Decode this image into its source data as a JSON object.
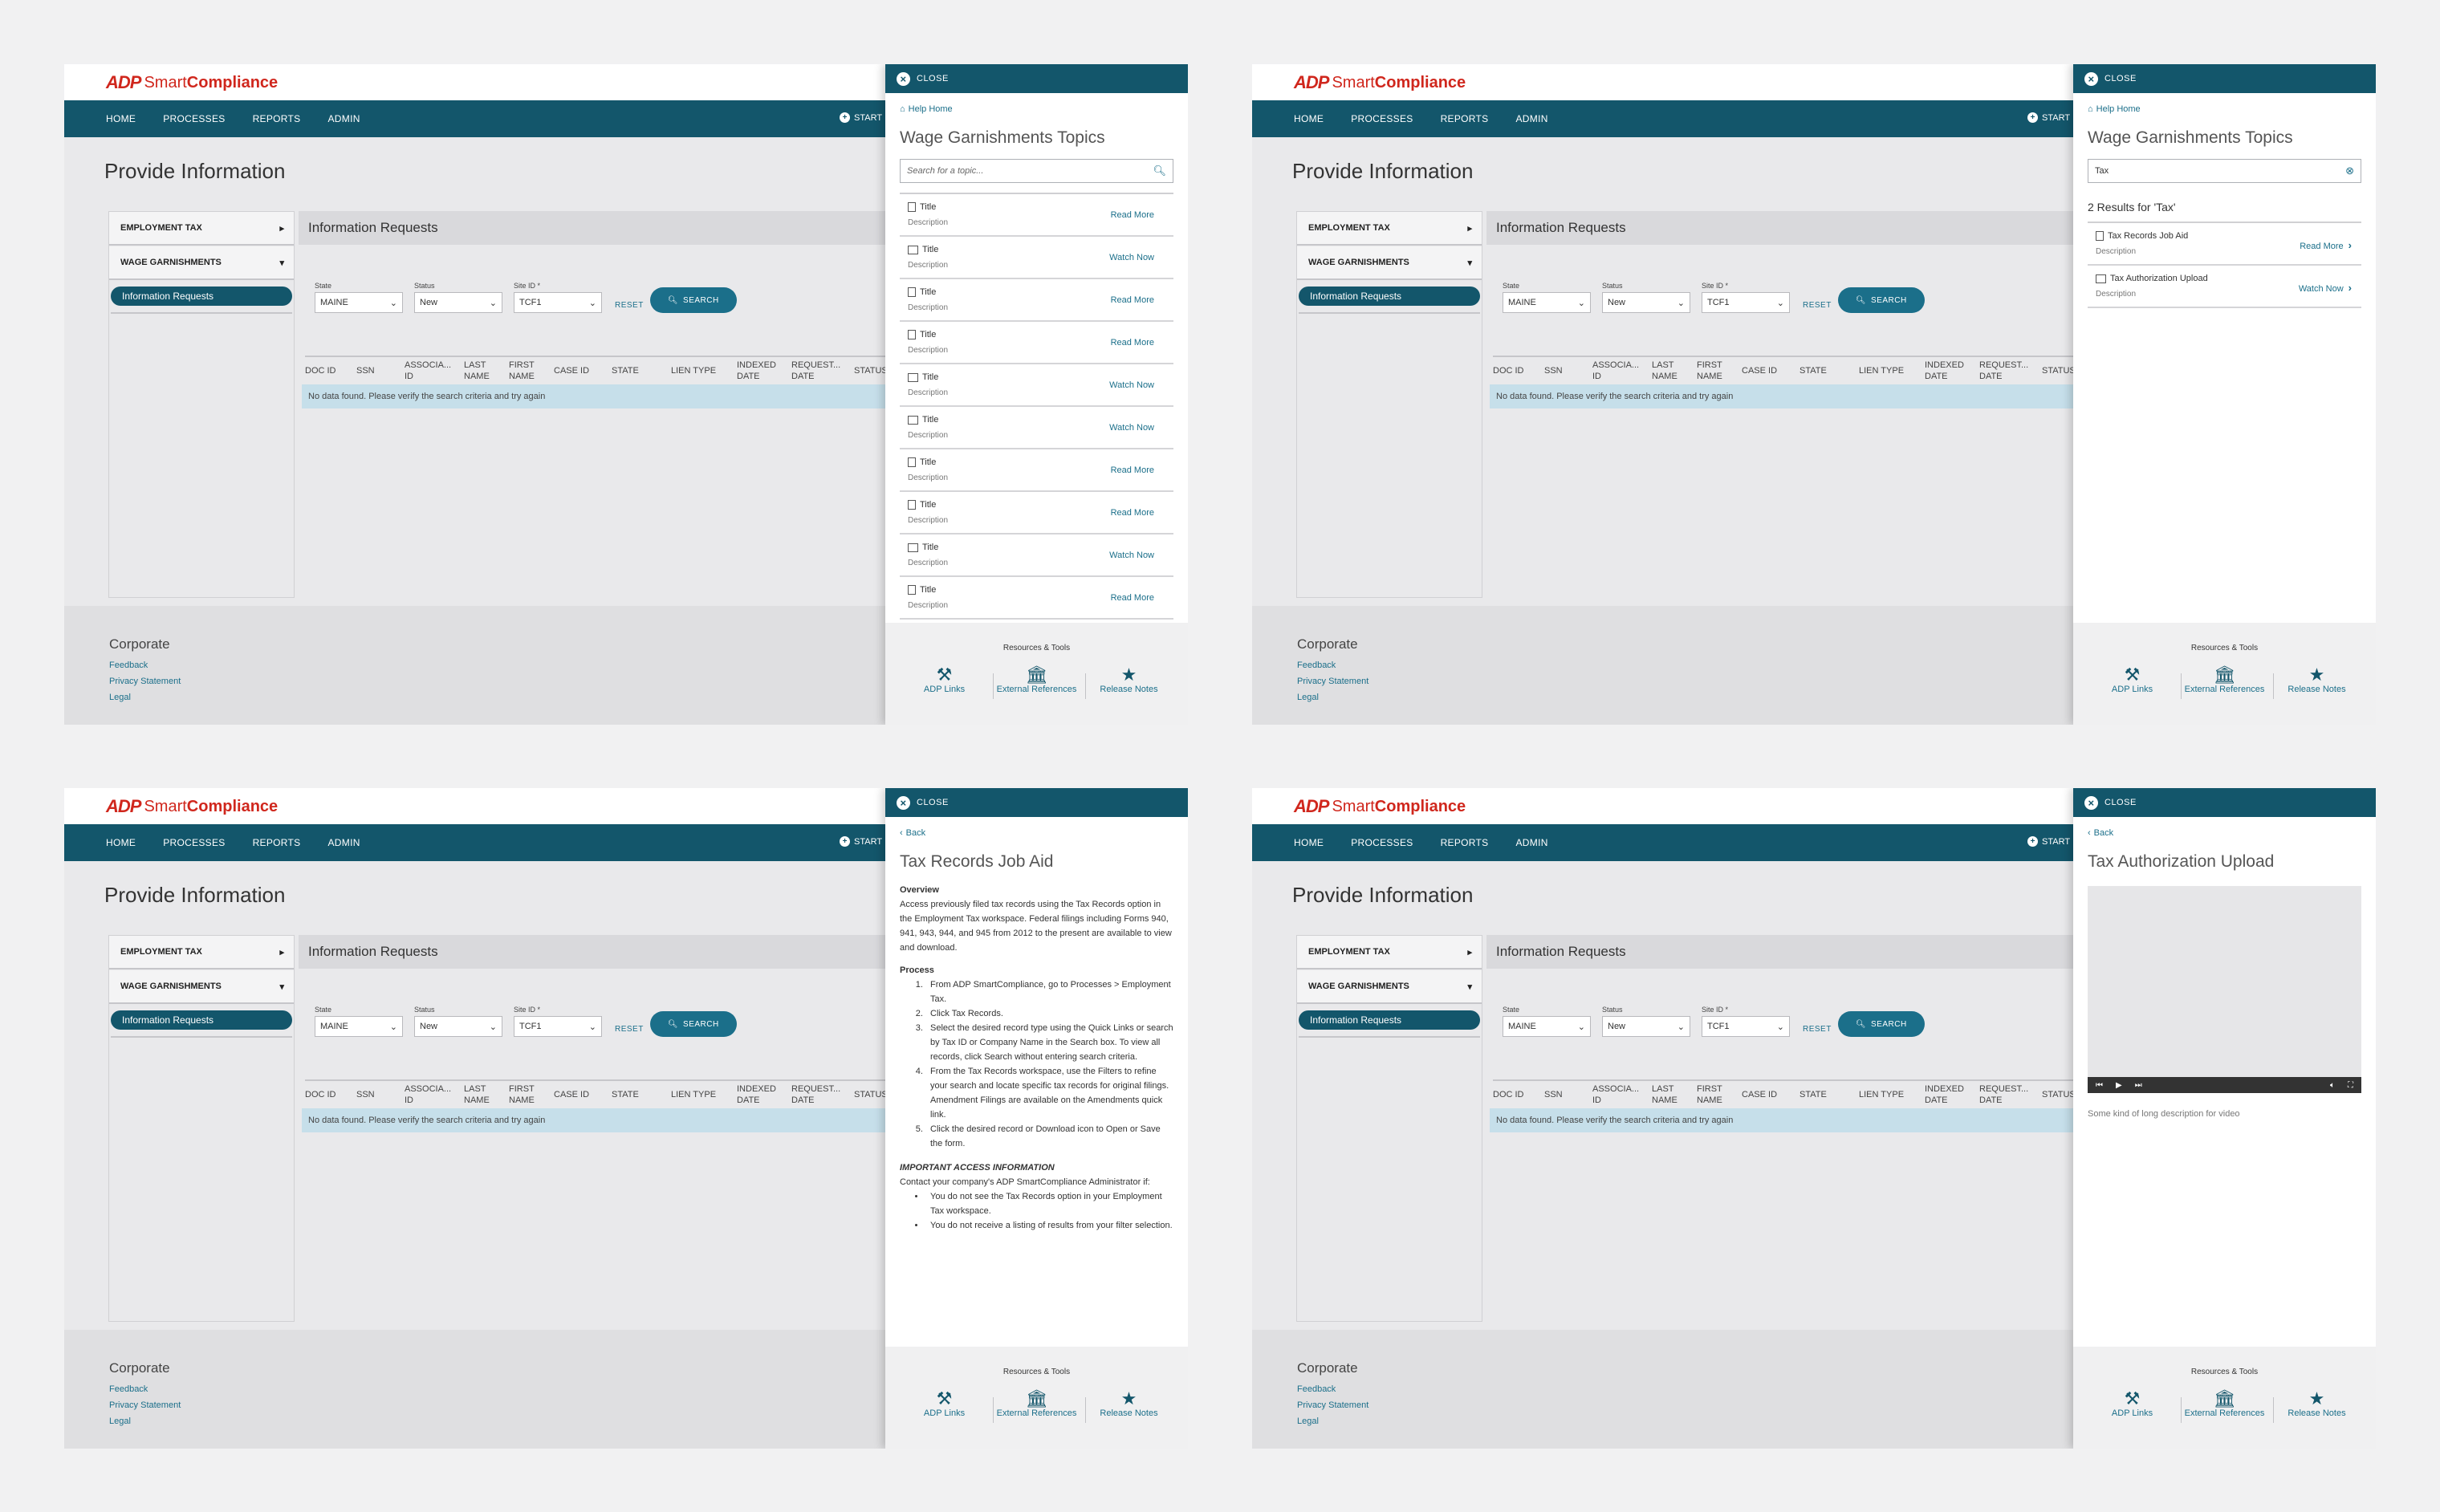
{
  "app": {
    "logo_badge": "ADP",
    "logo_smart": "Smart",
    "logo_compliance": "Compliance",
    "nav": [
      "HOME",
      "PROCESSES",
      "REPORTS",
      "ADMIN"
    ],
    "nav_right": "START",
    "page_title": "Provide Information",
    "sidebar": {
      "employment_tax": "EMPLOYMENT TAX",
      "wage_garnishments": "WAGE GARNISHMENTS",
      "active_item": "Information Requests"
    },
    "content_title": "Information Requests",
    "filters": {
      "state_label": "State",
      "state_value": "MAINE",
      "status_label": "Status",
      "status_value": "New",
      "site_label": "Site ID *",
      "site_value": "TCF1",
      "reset": "RESET",
      "search": "SEARCH"
    },
    "table": {
      "columns": [
        "DOC ID",
        "SSN",
        "ASSOCIA... ID",
        "LAST NAME",
        "FIRST NAME",
        "CASE ID",
        "STATE",
        "LIEN TYPE",
        "INDEXED DATE",
        "REQUEST... DATE",
        "STATUS"
      ],
      "empty": "No data found. Please verify the search criteria and try again"
    },
    "footer": {
      "title": "Corporate",
      "links": [
        "Feedback",
        "Privacy Statement",
        "Legal"
      ]
    }
  },
  "panel": {
    "close": "CLOSE",
    "help_home": "Help Home",
    "back": "Back",
    "topics_title": "Wage Garnishments Topics",
    "search_placeholder": "Search for a topic...",
    "search_value": "Tax",
    "topics": [
      {
        "type": "doc",
        "title": "Title",
        "desc": "Description",
        "action": "Read More"
      },
      {
        "type": "video",
        "title": "Title",
        "desc": "Description",
        "action": "Watch Now"
      },
      {
        "type": "doc",
        "title": "Title",
        "desc": "Description",
        "action": "Read More"
      },
      {
        "type": "doc",
        "title": "Title",
        "desc": "Description",
        "action": "Read More"
      },
      {
        "type": "video",
        "title": "Title",
        "desc": "Description",
        "action": "Watch Now"
      },
      {
        "type": "video",
        "title": "Title",
        "desc": "Description",
        "action": "Watch Now"
      },
      {
        "type": "doc",
        "title": "Title",
        "desc": "Description",
        "action": "Read More"
      },
      {
        "type": "doc",
        "title": "Title",
        "desc": "Description",
        "action": "Read More"
      },
      {
        "type": "video",
        "title": "Title",
        "desc": "Description",
        "action": "Watch Now"
      },
      {
        "type": "doc",
        "title": "Title",
        "desc": "Description",
        "action": "Read More"
      }
    ],
    "results_count": "2 Results for 'Tax'",
    "results": [
      {
        "type": "doc",
        "title": "Tax Records Job Aid",
        "desc": "Description",
        "action": "Read More"
      },
      {
        "type": "video",
        "title": "Tax Authorization Upload",
        "desc": "Description",
        "action": "Watch Now"
      }
    ],
    "article": {
      "title": "Tax Records Job Aid",
      "overview_h": "Overview",
      "overview": "Access previously filed tax records using the Tax Records option in the Employment Tax workspace.  Federal filings including Forms 940, 941, 943, 944, and 945 from 2012 to the present are available to view and download.",
      "process_h": "Process",
      "steps": [
        "From ADP SmartCompliance, go to Processes > Employment Tax.",
        "Click Tax Records.",
        "Select the desired record type using the Quick Links or search by Tax ID or Company Name in the Search box. To view all records, click Search without entering search criteria.",
        "From the Tax Records workspace, use the Filters to refine your search and locate specific tax records for original filings. Amendment Filings are available on the Amendments quick link.",
        "Click the desired record or Download icon to Open or Save the form."
      ],
      "important_h": "IMPORTANT ACCESS INFORMATION",
      "important": "Contact your company's ADP SmartCompliance Administrator if:",
      "bullets": [
        "You do not see the Tax Records option in your Employment Tax workspace.",
        "You do not receive a listing of results from your filter selection."
      ]
    },
    "video": {
      "title": "Tax Authorization Upload",
      "desc": "Some kind of long description for video"
    },
    "resources_title": "Resources & Tools",
    "tools": [
      "ADP Links",
      "External References",
      "Release Notes"
    ]
  },
  "colors": {
    "brand": "#13566b",
    "link": "#1b6f8a",
    "logo": "#d0271d"
  }
}
